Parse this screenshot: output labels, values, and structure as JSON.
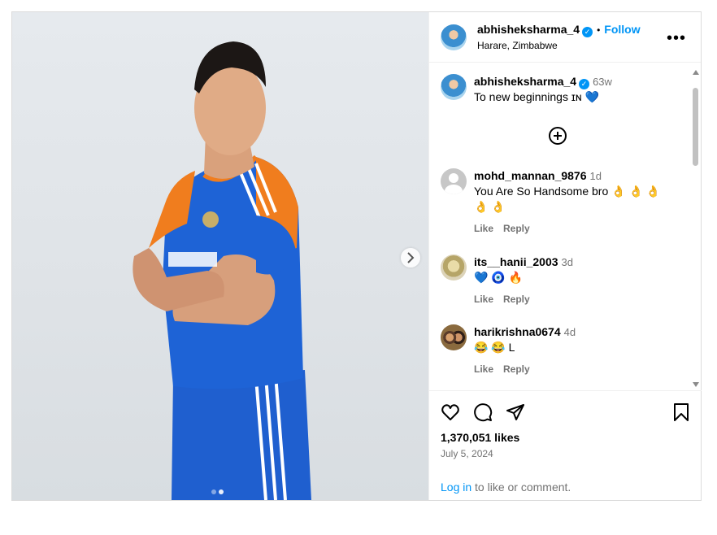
{
  "post": {
    "username": "abhisheksharma_4",
    "follow_label": "Follow",
    "location": "Harare, Zimbabwe",
    "caption": "To new beginnings ɪɴ 💙",
    "caption_time": "63w",
    "likes": "1,370,051 likes",
    "date": "July 5, 2024",
    "login_link": "Log in",
    "login_text": " to like or comment.",
    "carousel_index": 1,
    "carousel_count": 2
  },
  "comments": [
    {
      "username": "mohd_mannan_9876",
      "time": "1d",
      "text": "You Are So Handsome bro 👌 👌 👌 👌 👌",
      "like_label": "Like",
      "reply_label": "Reply"
    },
    {
      "username": "its__hanii_2003",
      "time": "3d",
      "text": "💙 🧿 🔥",
      "like_label": "Like",
      "reply_label": "Reply"
    },
    {
      "username": "harikrishna0674",
      "time": "4d",
      "text": "😂 😂 L",
      "like_label": "Like",
      "reply_label": "Reply"
    }
  ],
  "icons": [
    "heart-icon",
    "comment-icon",
    "share-icon",
    "bookmark-icon",
    "more-icon",
    "verified-icon",
    "add-comment-icon",
    "next-icon"
  ],
  "colors": {
    "accent": "#0095f6",
    "muted": "#737373",
    "border": "#dbdbdb"
  }
}
